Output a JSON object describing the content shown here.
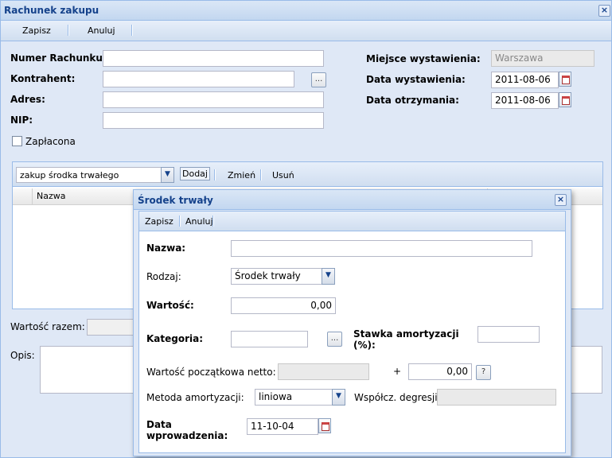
{
  "window": {
    "title": "Rachunek zakupu"
  },
  "toolbar": {
    "save": "Zapisz",
    "cancel": "Anuluj"
  },
  "form": {
    "numer_label": "Numer Rachunku:",
    "numer_value": "",
    "kontrahent_label": "Kontrahent:",
    "kontrahent_value": "",
    "kontrahent_btn": "...",
    "adres_label": "Adres:",
    "adres_value": "",
    "nip_label": "NIP:",
    "nip_value": "",
    "zaplacona_label": "Zapłacona",
    "miejsce_label": "Miejsce wystawienia:",
    "miejsce_value": "Warszawa",
    "data_wyst_label": "Data wystawienia:",
    "data_wyst_value": "2011-08-06",
    "data_otrz_label": "Data otrzymania:",
    "data_otrz_value": "2011-08-06"
  },
  "items": {
    "type_select": "zakup środka trwałego",
    "add": "Dodaj",
    "edit": "Zmień",
    "delete": "Usuń",
    "col_nazwa": "Nazwa"
  },
  "summary": {
    "wartosc_label": "Wartość razem:",
    "opis_label": "Opis:"
  },
  "dialog": {
    "title": "Środek trwały",
    "save": "Zapisz",
    "cancel": "Anuluj",
    "nazwa_label": "Nazwa:",
    "nazwa_value": "",
    "rodzaj_label": "Rodzaj:",
    "rodzaj_value": "Środek trwały",
    "wartosc_label": "Wartość:",
    "wartosc_value": "0,00",
    "kategoria_label": "Kategoria:",
    "kategoria_btn": "...",
    "stawka_label_1": "Stawka amortyzacji",
    "stawka_label_2": "(%):",
    "wpn_label": "Wartość początkowa netto:",
    "plus": "+",
    "wpn_extra_value": "0,00",
    "help_btn": "?",
    "metoda_label": "Metoda amortyzacji:",
    "metoda_value": "liniowa",
    "wspolcz_label": "Współcz. degresji:",
    "data_wpr_label_1": "Data",
    "data_wpr_label_2": "wprowadzenia:",
    "data_wpr_value": "11-10-04"
  }
}
